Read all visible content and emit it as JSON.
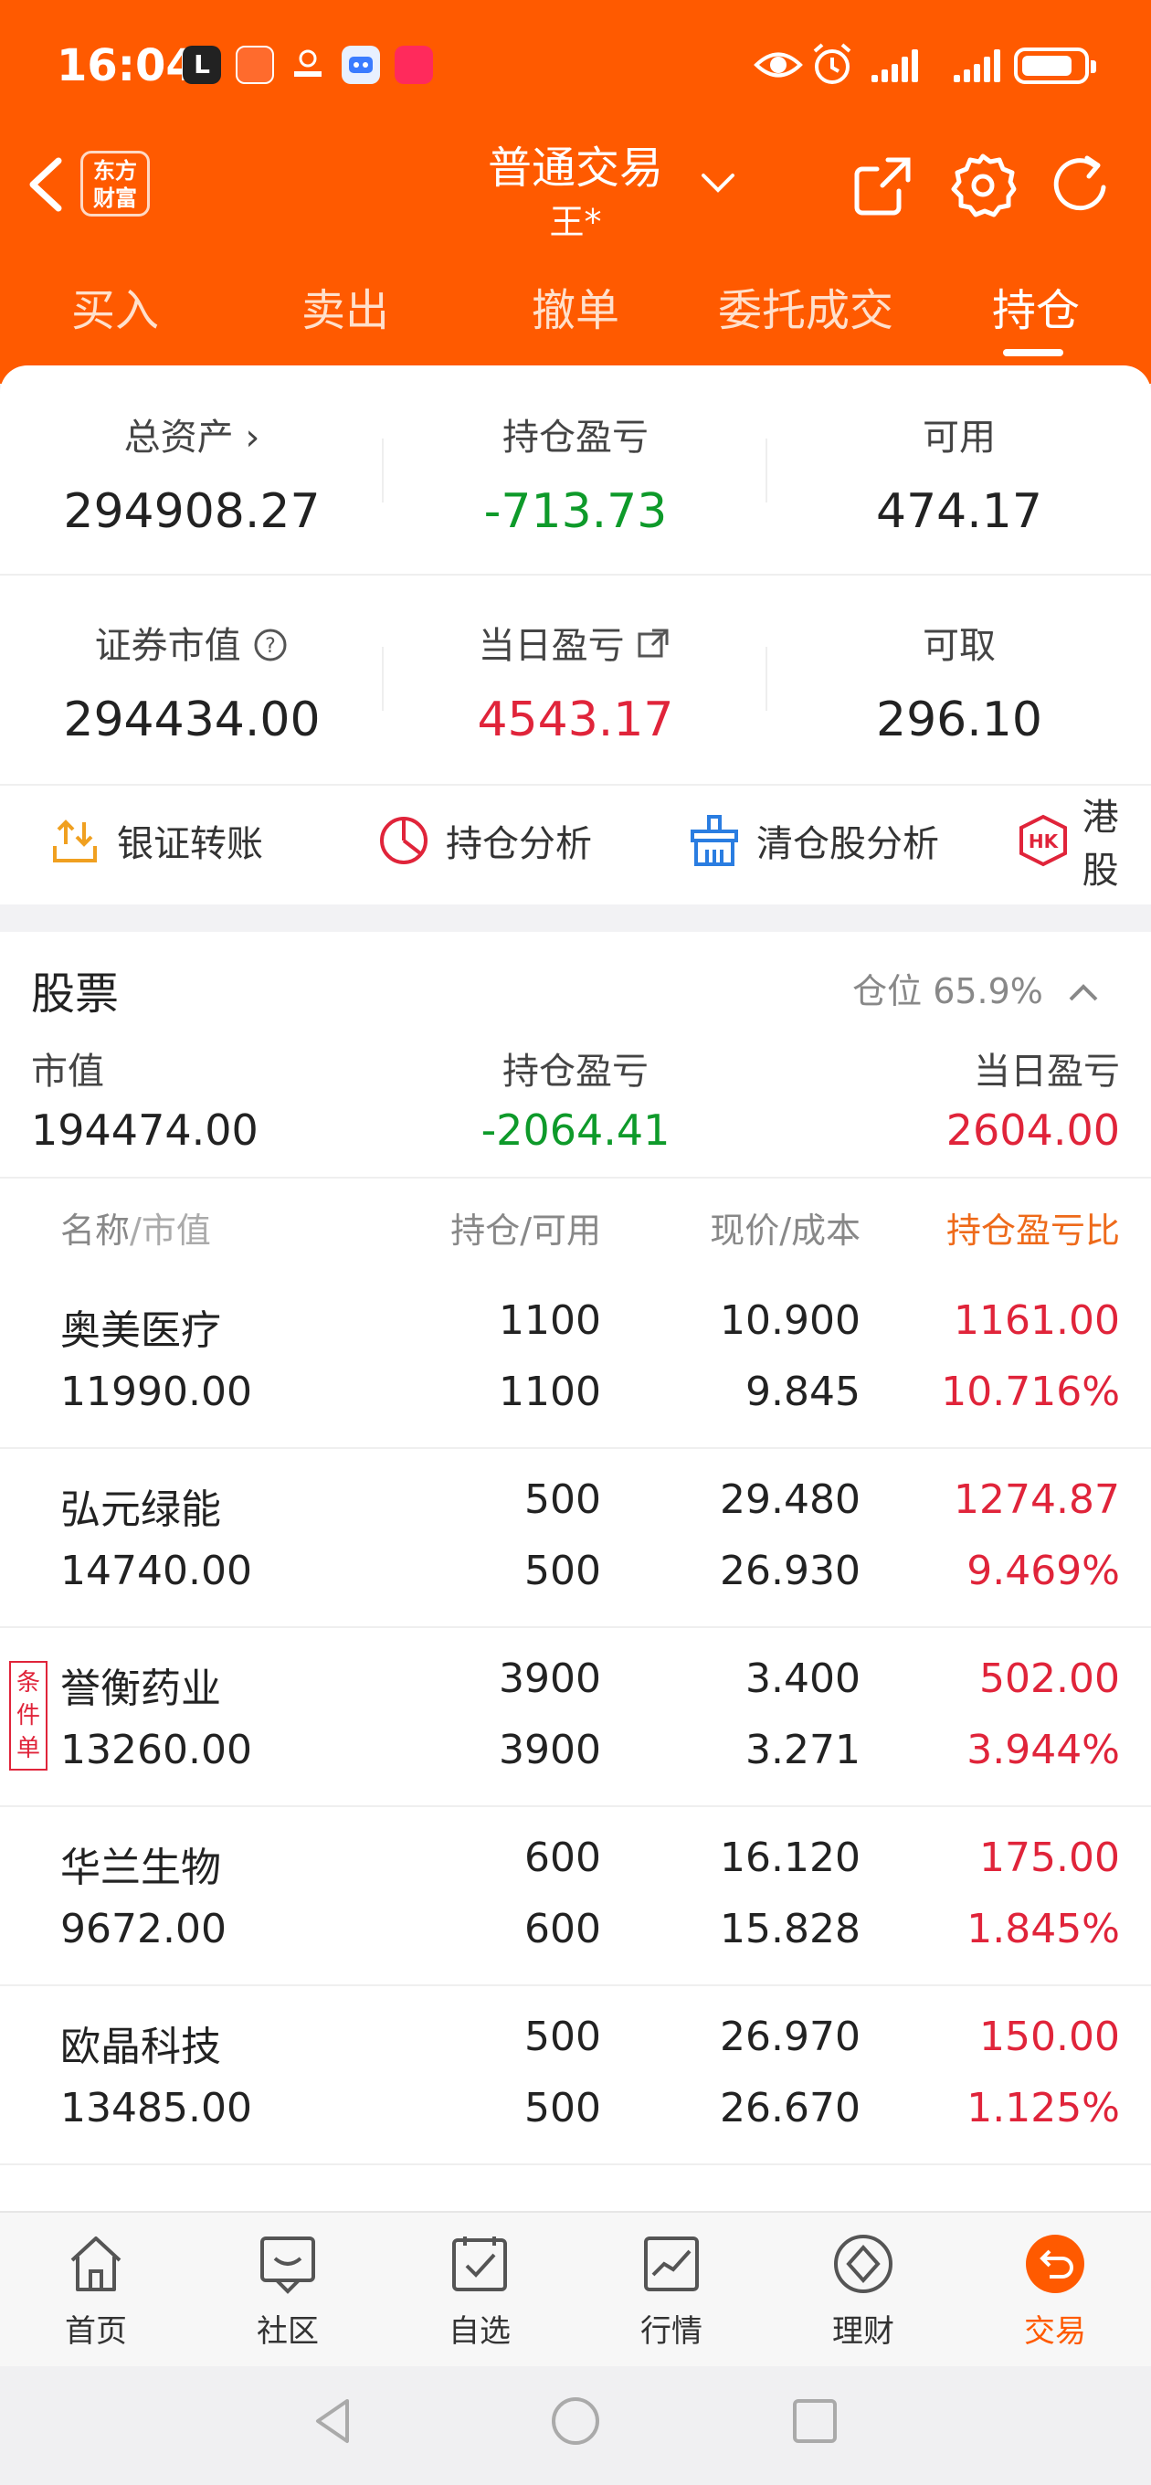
{
  "status_bar": {
    "time": "16:04",
    "app_l": "L"
  },
  "header": {
    "logo_line1": "东方",
    "logo_line2": "财富",
    "title": "普通交易",
    "account": "王*"
  },
  "tabs": [
    {
      "label": "买入"
    },
    {
      "label": "卖出"
    },
    {
      "label": "撤单"
    },
    {
      "label": "委托成交"
    },
    {
      "label": "持仓"
    }
  ],
  "assets": {
    "total_label": "总资产",
    "total_value": "294908.27",
    "pnl_label": "持仓盈亏",
    "pnl_value": "-713.73",
    "avail_label": "可用",
    "avail_value": "474.17",
    "mkt_label": "证券市值",
    "mkt_value": "294434.00",
    "daily_label": "当日盈亏",
    "daily_value": "4543.17",
    "withdraw_label": "可取",
    "withdraw_value": "296.10"
  },
  "tools": [
    {
      "label": "银证转账"
    },
    {
      "label": "持仓分析"
    },
    {
      "label": "清仓股分析"
    },
    {
      "label": "港股"
    }
  ],
  "stocks": {
    "title": "股票",
    "position_label": "仓位 65.9%",
    "summary": {
      "mkt_label": "市值",
      "mkt_value": "194474.00",
      "pnl_label": "持仓盈亏",
      "pnl_value": "-2064.41",
      "daily_label": "当日盈亏",
      "daily_value": "2604.00"
    },
    "columns": {
      "name": "名称",
      "mv": "/市值",
      "hold": "持仓/可用",
      "price": "现价/成本",
      "pnl": "持仓盈亏比"
    },
    "badge_text": "条件单",
    "rows": [
      {
        "name": "奥美医疗",
        "mv": "11990.00",
        "hold": "1100",
        "avail": "1100",
        "price": "10.900",
        "cost": "9.845",
        "pnl": "1161.00",
        "ratio": "10.716%"
      },
      {
        "name": "弘元绿能",
        "mv": "14740.00",
        "hold": "500",
        "avail": "500",
        "price": "29.480",
        "cost": "26.930",
        "pnl": "1274.87",
        "ratio": "9.469%"
      },
      {
        "name": "誉衡药业",
        "mv": "13260.00",
        "hold": "3900",
        "avail": "3900",
        "price": "3.400",
        "cost": "3.271",
        "pnl": "502.00",
        "ratio": "3.944%"
      },
      {
        "name": "华兰生物",
        "mv": "9672.00",
        "hold": "600",
        "avail": "600",
        "price": "16.120",
        "cost": "15.828",
        "pnl": "175.00",
        "ratio": "1.845%"
      },
      {
        "name": "欧晶科技",
        "mv": "13485.00",
        "hold": "500",
        "avail": "500",
        "price": "26.970",
        "cost": "26.670",
        "pnl": "150.00",
        "ratio": "1.125%"
      }
    ]
  },
  "bottom_nav": [
    {
      "label": "首页",
      "icon": "home-icon"
    },
    {
      "label": "社区",
      "icon": "chat-icon"
    },
    {
      "label": "自选",
      "icon": "checklist-icon"
    },
    {
      "label": "行情",
      "icon": "chart-icon"
    },
    {
      "label": "理财",
      "icon": "diamond-icon"
    },
    {
      "label": "交易",
      "icon": "trade-icon"
    }
  ],
  "colors": {
    "brand": "#ff5a00",
    "loss": "#0e9a2a",
    "gain": "#e0243a"
  }
}
